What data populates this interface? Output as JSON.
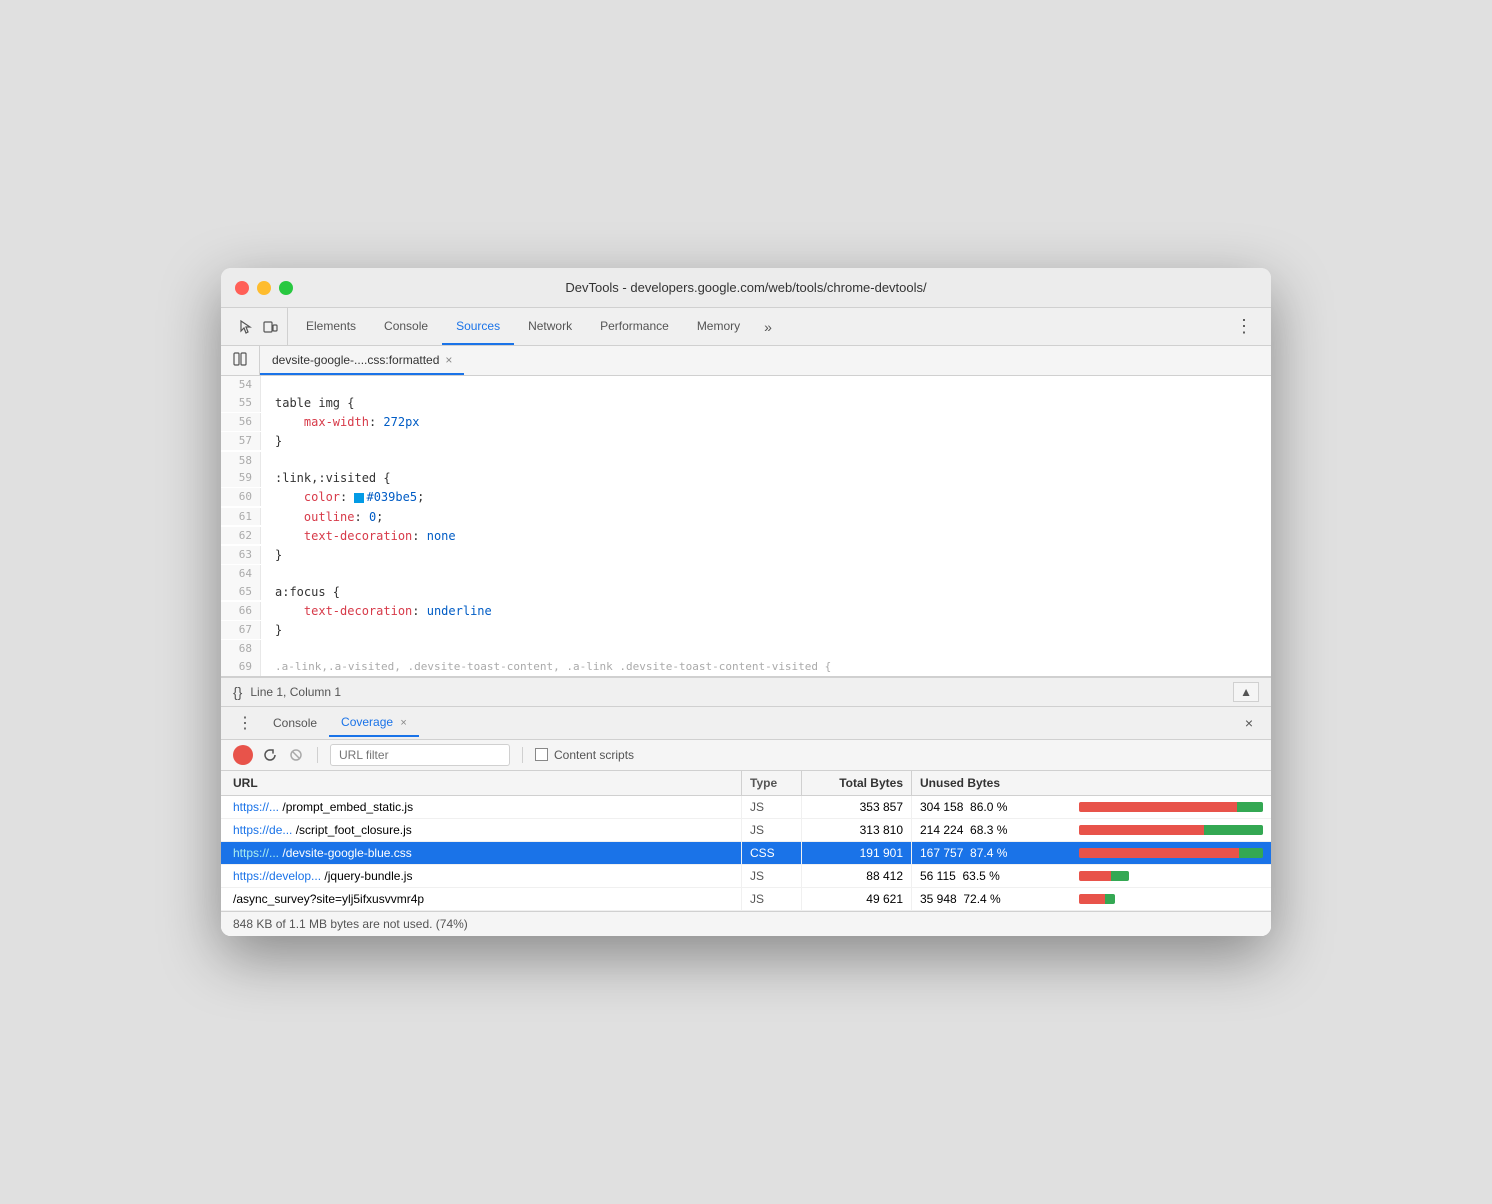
{
  "window": {
    "title": "DevTools - developers.google.com/web/tools/chrome-devtools/"
  },
  "traffic_lights": {
    "close_label": "close",
    "minimize_label": "minimize",
    "maximize_label": "maximize"
  },
  "devtools_tabs": {
    "items": [
      {
        "id": "elements",
        "label": "Elements"
      },
      {
        "id": "console",
        "label": "Console"
      },
      {
        "id": "sources",
        "label": "Sources",
        "active": true
      },
      {
        "id": "network",
        "label": "Network"
      },
      {
        "id": "performance",
        "label": "Performance"
      },
      {
        "id": "memory",
        "label": "Memory"
      }
    ],
    "more_label": "»",
    "menu_label": "⋮"
  },
  "source_tab": {
    "filename": "devsite-google-....css:formatted",
    "close_label": "×"
  },
  "code_lines": [
    {
      "num": "54",
      "content": "",
      "gutter": false
    },
    {
      "num": "55",
      "content": "table img {",
      "gutter": true
    },
    {
      "num": "56",
      "content": "    max-width: 272px",
      "gutter": true,
      "has_prop": true,
      "prop": "max-width",
      "val": "272px"
    },
    {
      "num": "57",
      "content": "}",
      "gutter": true
    },
    {
      "num": "58",
      "content": "",
      "gutter": false
    },
    {
      "num": "59",
      "content": ":link,:visited {",
      "gutter": true
    },
    {
      "num": "60",
      "content": "    color: #039be5;",
      "gutter": true,
      "has_color": true
    },
    {
      "num": "61",
      "content": "    outline: 0;",
      "gutter": true,
      "has_prop": true,
      "prop": "outline",
      "val": "0"
    },
    {
      "num": "62",
      "content": "    text-decoration: none",
      "gutter": true,
      "has_prop": true,
      "prop": "text-decoration",
      "val": "none"
    },
    {
      "num": "63",
      "content": "}",
      "gutter": true
    },
    {
      "num": "64",
      "content": "",
      "gutter": false
    },
    {
      "num": "65",
      "content": "a:focus {",
      "gutter": true
    },
    {
      "num": "66",
      "content": "    text-decoration: underline",
      "gutter": true,
      "has_prop": true,
      "prop": "text-decoration",
      "val": "underline"
    },
    {
      "num": "67",
      "content": "}",
      "gutter": true
    },
    {
      "num": "68",
      "content": "",
      "gutter": false
    },
    {
      "num": "69",
      "content": ".a-link,.a-visited, .devsite-toast-content, .a-link .devsite-toast-content-visited {",
      "gutter": false,
      "truncated": true
    }
  ],
  "status_bar": {
    "curly_icon": "{}",
    "position": "Line 1, Column 1",
    "scroll_icon": "▲"
  },
  "bottom_panel": {
    "tabs": [
      {
        "id": "console",
        "label": "Console"
      },
      {
        "id": "coverage",
        "label": "Coverage",
        "active": true
      }
    ],
    "dots_icon": "⋮",
    "close_label": "×"
  },
  "coverage_toolbar": {
    "url_filter_placeholder": "URL filter",
    "content_scripts_label": "Content scripts",
    "separator": "|"
  },
  "coverage_table": {
    "headers": {
      "url": "URL",
      "type": "Type",
      "total_bytes": "Total Bytes",
      "unused_bytes": "Unused Bytes",
      "bar": ""
    },
    "rows": [
      {
        "url": "https://... /prompt_embed_static.js",
        "type": "JS",
        "total_bytes": "353 857",
        "unused_bytes": "304 158",
        "unused_pct": "86.0 %",
        "bar_unused_pct": 86,
        "bar_used_pct": 14,
        "selected": false
      },
      {
        "url": "https://de... /script_foot_closure.js",
        "type": "JS",
        "total_bytes": "313 810",
        "unused_bytes": "214 224",
        "unused_pct": "68.3 %",
        "bar_unused_pct": 68,
        "bar_used_pct": 32,
        "selected": false
      },
      {
        "url": "https://... /devsite-google-blue.css",
        "type": "CSS",
        "total_bytes": "191 901",
        "unused_bytes": "167 757",
        "unused_pct": "87.4 %",
        "bar_unused_pct": 87,
        "bar_used_pct": 13,
        "selected": true
      },
      {
        "url": "https://develop... /jquery-bundle.js",
        "type": "JS",
        "total_bytes": "88 412",
        "unused_bytes": "56 115",
        "unused_pct": "63.5 %",
        "bar_unused_pct": 64,
        "bar_used_pct": 36,
        "selected": false
      },
      {
        "url": "/async_survey?site=ylj5ifxusvvmr4p",
        "type": "JS",
        "total_bytes": "49 621",
        "unused_bytes": "35 948",
        "unused_pct": "72.4 %",
        "bar_unused_pct": 72,
        "bar_used_pct": 28,
        "selected": false
      }
    ],
    "footer": "848 KB of 1.1 MB bytes are not used. (74%)"
  }
}
